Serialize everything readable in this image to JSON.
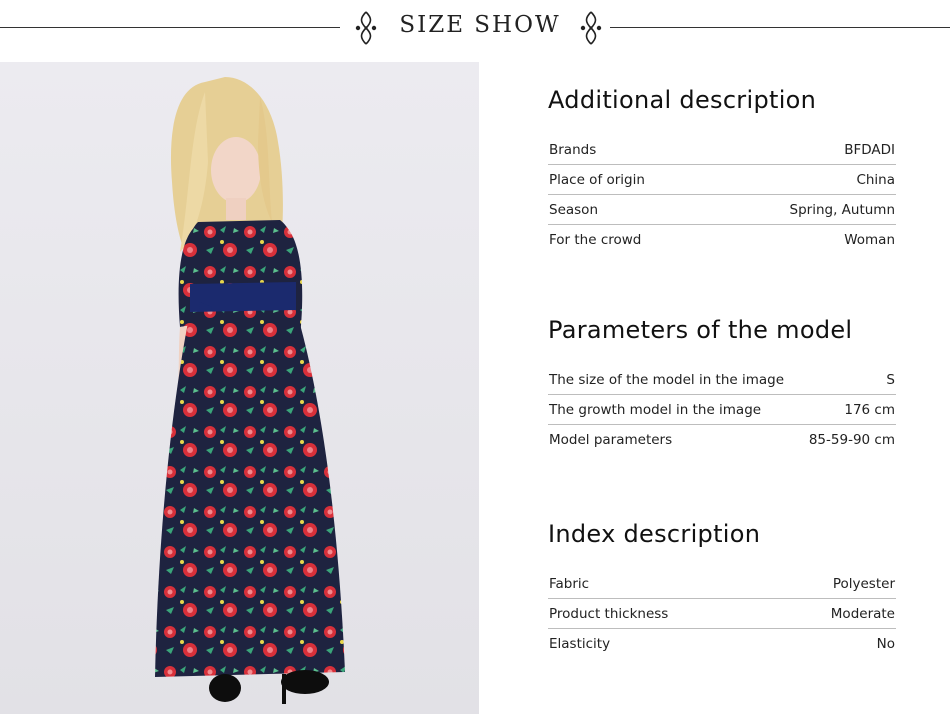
{
  "header": {
    "title": "SIZE SHOW"
  },
  "sections": [
    {
      "title": "Additional description",
      "rows": [
        {
          "key": "Brands",
          "value": "BFDADI"
        },
        {
          "key": "Place of origin",
          "value": "China"
        },
        {
          "key": "Season",
          "value": "Spring, Autumn"
        },
        {
          "key": "For the crowd",
          "value": "Woman"
        }
      ]
    },
    {
      "title": "Parameters of the model",
      "rows": [
        {
          "key": "The size of the model in the image",
          "value": "S"
        },
        {
          "key": "The growth model in the image",
          "value": "176 cm"
        },
        {
          "key": "Model parameters",
          "value": "85-59-90 cm"
        }
      ]
    },
    {
      "title": "Index description",
      "rows": [
        {
          "key": "Fabric",
          "value": "Polyester"
        },
        {
          "key": "Product thickness",
          "value": "Moderate"
        },
        {
          "key": "Elasticity",
          "value": "No"
        }
      ]
    }
  ],
  "colors": {
    "dress": "#1e2340",
    "flower_red": "#d8303a",
    "leaf_green": "#3aa57a",
    "belt": "#1b2a6e",
    "hair": "#e8d29a"
  }
}
